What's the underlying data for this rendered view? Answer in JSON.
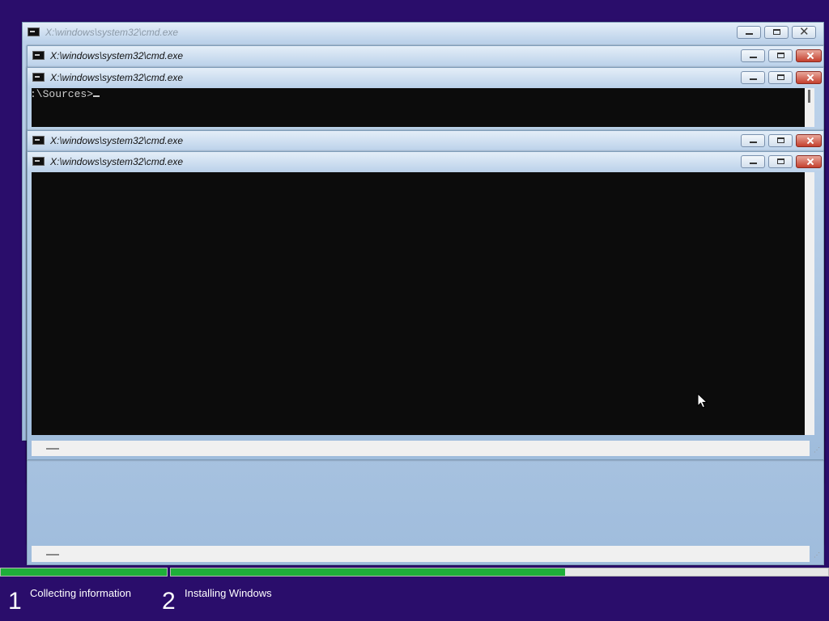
{
  "windows": [
    {
      "title": "X:\\windows\\system32\\cmd.exe"
    },
    {
      "title": "X:\\windows\\system32\\cmd.exe"
    },
    {
      "title": "X:\\windows\\system32\\cmd.exe"
    },
    {
      "title": "X:\\windows\\system32\\cmd.exe"
    },
    {
      "title": "X:\\windows\\system32\\cmd.exe"
    }
  ],
  "console": {
    "prompt": ":\\Sources>"
  },
  "setup": {
    "steps": [
      {
        "number": "1",
        "label": "Collecting information"
      },
      {
        "number": "2",
        "label": "Installing Windows"
      }
    ],
    "progress": [
      1.0,
      0.6
    ]
  },
  "colors": {
    "desktop": "#2a0d6b",
    "progress": "#1fae3a"
  }
}
